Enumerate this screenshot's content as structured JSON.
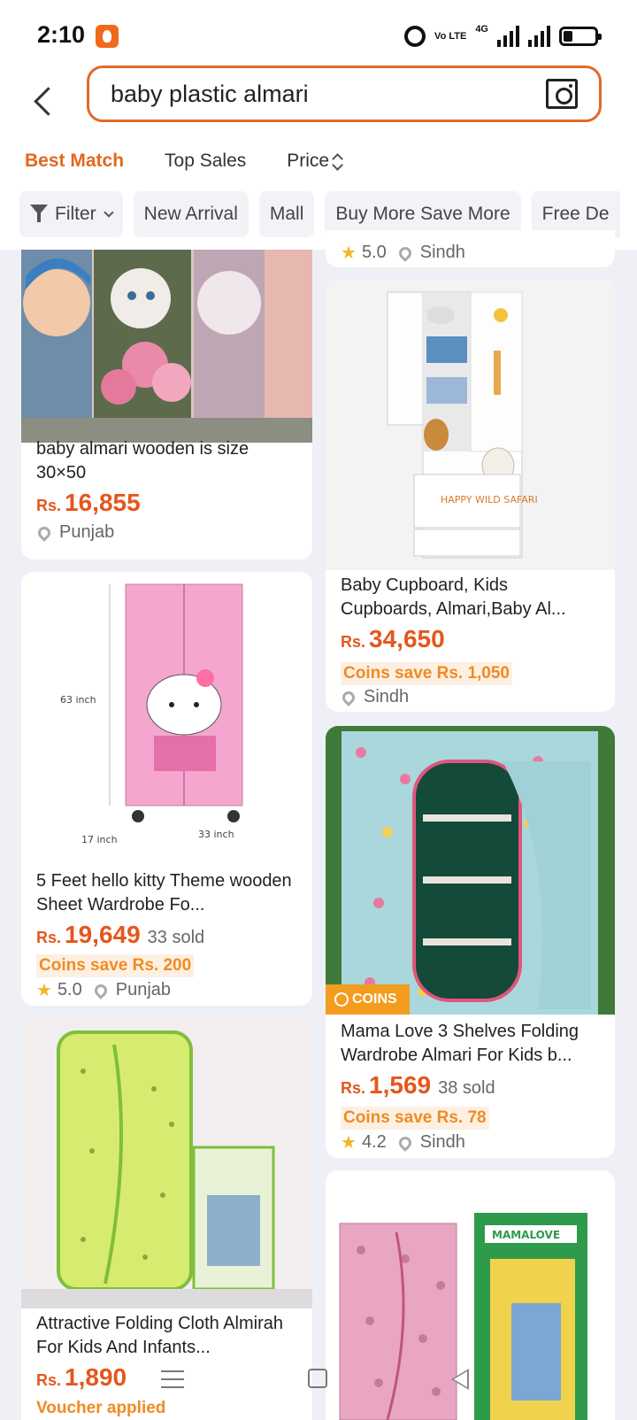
{
  "status_bar": {
    "time": "2:10",
    "volte": "Vo LTE",
    "network": "4G"
  },
  "search": {
    "query": "baby plastic almari"
  },
  "sort_tabs": [
    {
      "label": "Best Match",
      "active": true
    },
    {
      "label": "Top Sales",
      "active": false
    },
    {
      "label": "Price",
      "active": false
    }
  ],
  "filters": [
    "Filter",
    "New Arrival",
    "Mall",
    "Buy More Save More",
    "Free De"
  ],
  "colors": {
    "accent": "#e4671d",
    "price": "#e4571d",
    "coins_text": "#f08b22",
    "coins_badge": "#f49c1e"
  },
  "products": {
    "top_right_partial": {
      "rating": "5.0",
      "location": "Sindh"
    },
    "p1": {
      "title": "baby almari wooden is size 30×50",
      "currency": "Rs.",
      "price": "16,855",
      "location": "Punjab"
    },
    "p2": {
      "title": "Baby Cupboard, Kids Cupboards, Almari,Baby Al...",
      "currency": "Rs.",
      "price": "34,650",
      "coins": "Coins save Rs. 1,050",
      "location": "Sindh",
      "image_text": "HAPPY WILD SAFARI"
    },
    "p3": {
      "title": "5 Feet hello kitty Theme wooden Sheet Wardrobe Fo...",
      "currency": "Rs.",
      "price": "19,649",
      "sold": "33 sold",
      "coins": "Coins save Rs. 200",
      "rating": "5.0",
      "location": "Punjab",
      "dim_height": "63 inch",
      "dim_depth": "17 inch",
      "dim_width": "33 inch"
    },
    "p4": {
      "badge": "COINS",
      "title": "Mama Love 3 Shelves Folding Wardrobe Almari For Kids b...",
      "currency": "Rs.",
      "price": "1,569",
      "sold": "38 sold",
      "coins": "Coins save Rs. 78",
      "rating": "4.2",
      "location": "Sindh"
    },
    "p5": {
      "title": "Attractive Folding Cloth Almirah For Kids And Infants...",
      "currency": "Rs.",
      "price": "1,890",
      "voucher": "Voucher applied"
    },
    "p6": {
      "box_brand": "MAMALOVE"
    }
  }
}
